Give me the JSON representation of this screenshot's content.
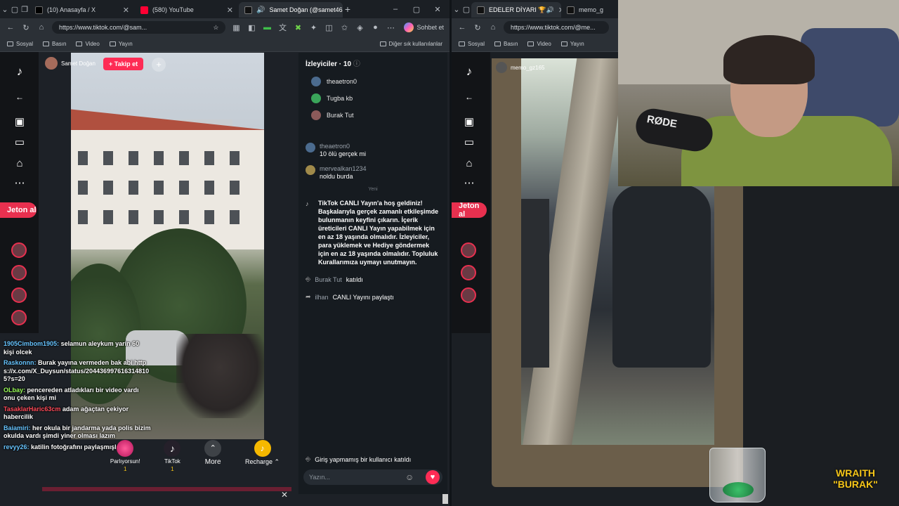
{
  "left_browser": {
    "tabs": [
      {
        "label": "(10) Anasayfa / X",
        "fav_color": "#000000"
      },
      {
        "label": "(580) YouTube",
        "fav_color": "#ff0033"
      },
      {
        "label": "Samet Doğan (@samet46",
        "fav_color": "#111111",
        "active": true
      }
    ],
    "url": "https://www.tiktok.com/@sam...",
    "sohbet_label": "Sohbet et",
    "bookmarks": [
      "Sosyal",
      "Basın",
      "Video",
      "Yayın"
    ],
    "other_bookmarks": "Diğer sık kullanılanlar"
  },
  "right_browser": {
    "tabs": [
      {
        "label": "EDELER DİYARI 🏆🔊",
        "active": true
      },
      {
        "label": "memo_gz"
      }
    ],
    "url": "https://www.tiktok.com/@me...",
    "bookmarks": [
      "Sosyal",
      "Basın",
      "Video",
      "Yayın"
    ],
    "streamer_name": "memo_gz165"
  },
  "tiktok_rail": {
    "jeton_label": "Jeton al"
  },
  "stream_left": {
    "streamer_name": "Samet Doğan",
    "follow_label": "+ Takip et",
    "plus_label": "+"
  },
  "overlay_chat": [
    {
      "user": "1905Cimbom1905:",
      "text": "selamun aleykum yarin 60 kişi olcek",
      "color": "blue"
    },
    {
      "user": "Raskonnn:",
      "text": "Burak yayına vermeden bak abi https://x.com/X_Duysun/status/2044369976163148105?s=20",
      "color": "blue"
    },
    {
      "user": "OLbay:",
      "text": "pencereden atladıkları bir video vardı onu çeken kişi mi",
      "color": "green"
    },
    {
      "user": "TasaklarHaric63cm",
      "text": "adam ağaçtan çekiyor habercilik",
      "color": "red"
    },
    {
      "user": "Baiamiri:",
      "text": "her okula bir jandarma yada polis bizim okulda vardı şimdi yiner olması lazım",
      "color": "blue"
    },
    {
      "user": "revyy26:",
      "text": "katilin fotoğrafını paylaşmışlar",
      "color": "blue"
    }
  ],
  "gifts": [
    {
      "label": "Parlıyorsun!",
      "count": "1"
    },
    {
      "label": "TikTok",
      "count": "1"
    },
    {
      "label": "More",
      "count": ""
    },
    {
      "label": "Recharge ⌃",
      "count": ""
    }
  ],
  "viewers_panel": {
    "title": "İzleyiciler · 10",
    "viewers": [
      "theaetron0",
      "Tugba kb",
      "Burak Tut"
    ]
  },
  "comments": [
    {
      "name": "theaetron0",
      "text": "10 ölü gerçek mi"
    },
    {
      "name": "mervealkan1234",
      "text": "noldu burda"
    }
  ],
  "divider_label": "Yeni",
  "system_message": "TikTok CANLI Yayın'a hoş geldiniz! Başkalarıyla gerçek zamanlı etkileşimde bulunmanın keyfini çıkarın. İçerik üreticileri CANLI Yayın yapabilmek için en az 18 yaşında olmalıdır. İzleyiciler, para yüklemek ve Hediye göndermek için en az 18 yaşında olmalıdır. Topluluk Kurallarımıza uymayı unutmayın.",
  "events": [
    {
      "name": "Burak Tut",
      "text": "katıldı"
    },
    {
      "name": "ilhan",
      "text": "CANLI Yayını paylaştı"
    }
  ],
  "guest_joined": "Giriş yapmamış bir kullanıcı katıldı",
  "input_placeholder": "Yazın...",
  "webcam": {
    "mic_brand": "RØDE"
  },
  "brand_logo": {
    "line1": "WRAITH",
    "line2": "\"BURAK\""
  }
}
